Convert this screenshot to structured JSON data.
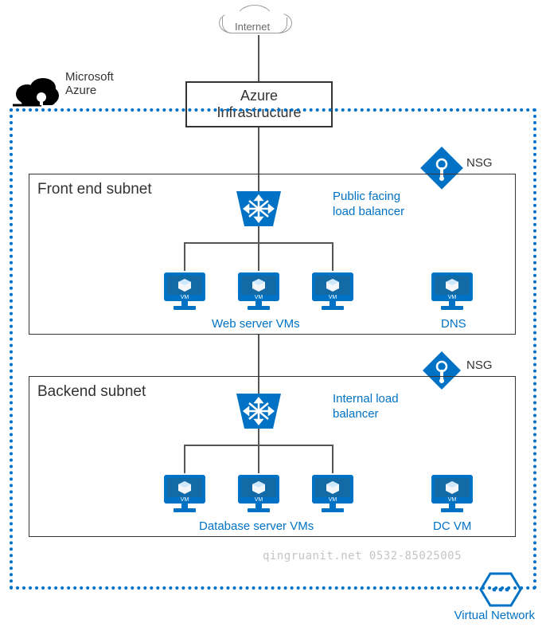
{
  "internet_label": "Internet",
  "azure_brand_line1": "Microsoft",
  "azure_brand_line2": "Azure",
  "infra_line1": "Azure",
  "infra_line2": "Infrastructure",
  "nsg_label": "NSG",
  "frontend": {
    "title": "Front end subnet",
    "lb_label_line1": "Public facing",
    "lb_label_line2": "load balancer",
    "vms_label": "Web server VMs",
    "extra_label": "DNS"
  },
  "backend": {
    "title": "Backend subnet",
    "lb_label_line1": "Internal load",
    "lb_label_line2": "balancer",
    "vms_label": "Database server VMs",
    "extra_label": "DC VM"
  },
  "vnet_label": "Virtual Network",
  "vm_caption": "VM",
  "watermark": "qingruanit.net 0532-85025005",
  "colors": {
    "azure": "#0072c6",
    "dark": "#333"
  }
}
